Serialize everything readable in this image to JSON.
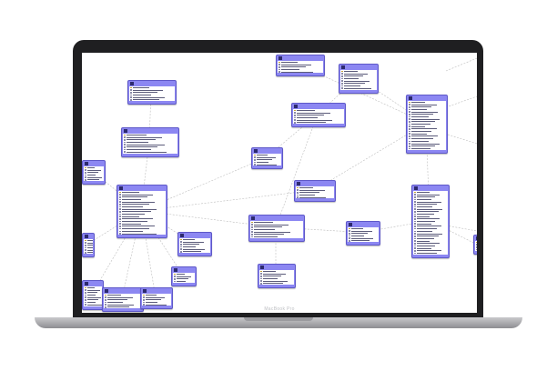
{
  "device": {
    "brand_label": "MacBook Pro"
  },
  "colors": {
    "table_fill": "#8c87f2",
    "table_border": "#5e58c8",
    "key_icon": "#c6a33a",
    "connector": "#bdbdbd"
  },
  "tables": [
    {
      "id": "t1",
      "rows": 6
    },
    {
      "id": "t2",
      "rows": 8
    },
    {
      "id": "t3",
      "rows": 6
    },
    {
      "id": "t4",
      "rows": 18
    },
    {
      "id": "t5",
      "rows": 5
    },
    {
      "id": "t6",
      "rows": 6
    },
    {
      "id": "t7",
      "rows": 8
    },
    {
      "id": "t8",
      "rows": 5
    },
    {
      "id": "t9",
      "rows": 20
    },
    {
      "id": "t10",
      "rows": 7
    },
    {
      "id": "t11",
      "rows": 6
    },
    {
      "id": "t12",
      "rows": 26
    },
    {
      "id": "t13",
      "rows": 6
    },
    {
      "id": "t14",
      "rows": 8
    },
    {
      "id": "t15",
      "rows": 6
    },
    {
      "id": "t16",
      "rows": 6
    },
    {
      "id": "t17",
      "rows": 6
    },
    {
      "id": "t18",
      "rows": 4
    },
    {
      "id": "t19",
      "rows": 5
    },
    {
      "id": "t20",
      "rows": 4
    },
    {
      "id": "t21",
      "rows": 5
    }
  ],
  "relations": [
    [
      "t1",
      "t2"
    ],
    [
      "t2",
      "t4"
    ],
    [
      "t3",
      "t4"
    ],
    [
      "t4",
      "t5"
    ],
    [
      "t5",
      "t6"
    ],
    [
      "t6",
      "t7"
    ],
    [
      "t4",
      "t8"
    ],
    [
      "t8",
      "t9"
    ],
    [
      "t4",
      "t10"
    ],
    [
      "t10",
      "t11"
    ],
    [
      "t11",
      "t12"
    ],
    [
      "t9",
      "t12"
    ],
    [
      "t4",
      "t13"
    ],
    [
      "t4",
      "t14"
    ],
    [
      "t4",
      "t15"
    ],
    [
      "t10",
      "t16"
    ],
    [
      "t4",
      "t17"
    ],
    [
      "t7",
      "t9"
    ],
    [
      "t6",
      "t10"
    ],
    [
      "t4",
      "t18"
    ],
    [
      "t9",
      "t19"
    ],
    [
      "t12",
      "t20"
    ],
    [
      "t4",
      "t21"
    ]
  ]
}
